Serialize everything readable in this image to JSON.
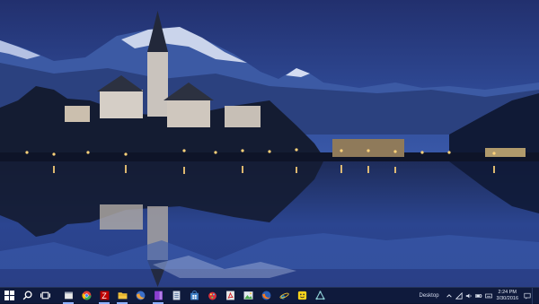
{
  "taskbar": {
    "start_icon": "windows-logo",
    "search_icon": "search-icon",
    "taskview_icon": "task-view-icon",
    "apps": [
      {
        "name": "app-window-icon",
        "color": "#e9e9e9"
      },
      {
        "name": "chrome-icon",
        "color": "#e44134"
      },
      {
        "name": "filezilla-icon",
        "color": "#bf0000"
      },
      {
        "name": "file-explorer-icon",
        "color": "#f4c542"
      },
      {
        "name": "firefox-old-icon",
        "color": "#f2a33a"
      },
      {
        "name": "onenote-icon",
        "color": "#8a3fd1"
      },
      {
        "name": "notepad-icon",
        "color": "#cfd8e6"
      },
      {
        "name": "store-icon",
        "color": "#3f80c6"
      },
      {
        "name": "paint-icon",
        "color": "#d8303a"
      },
      {
        "name": "acrobat-icon",
        "color": "#e8e8e8"
      },
      {
        "name": "image-viewer-icon",
        "color": "#4caa4f"
      },
      {
        "name": "firefox-icon",
        "color": "#ff7a1a"
      },
      {
        "name": "internet-explorer-icon",
        "color": "#2aa4e6"
      },
      {
        "name": "emoji-app-icon",
        "color": "#f7d21c"
      },
      {
        "name": "network-app-icon",
        "color": "#8fd0d6"
      }
    ],
    "tray": {
      "desktop_label": "Desktop",
      "icons": [
        "chevron-up-icon",
        "network-icon",
        "volume-icon",
        "battery-icon",
        "keyboard-icon",
        "notifications-icon"
      ],
      "time": "2:24 PM",
      "date": "3/30/2016"
    }
  }
}
